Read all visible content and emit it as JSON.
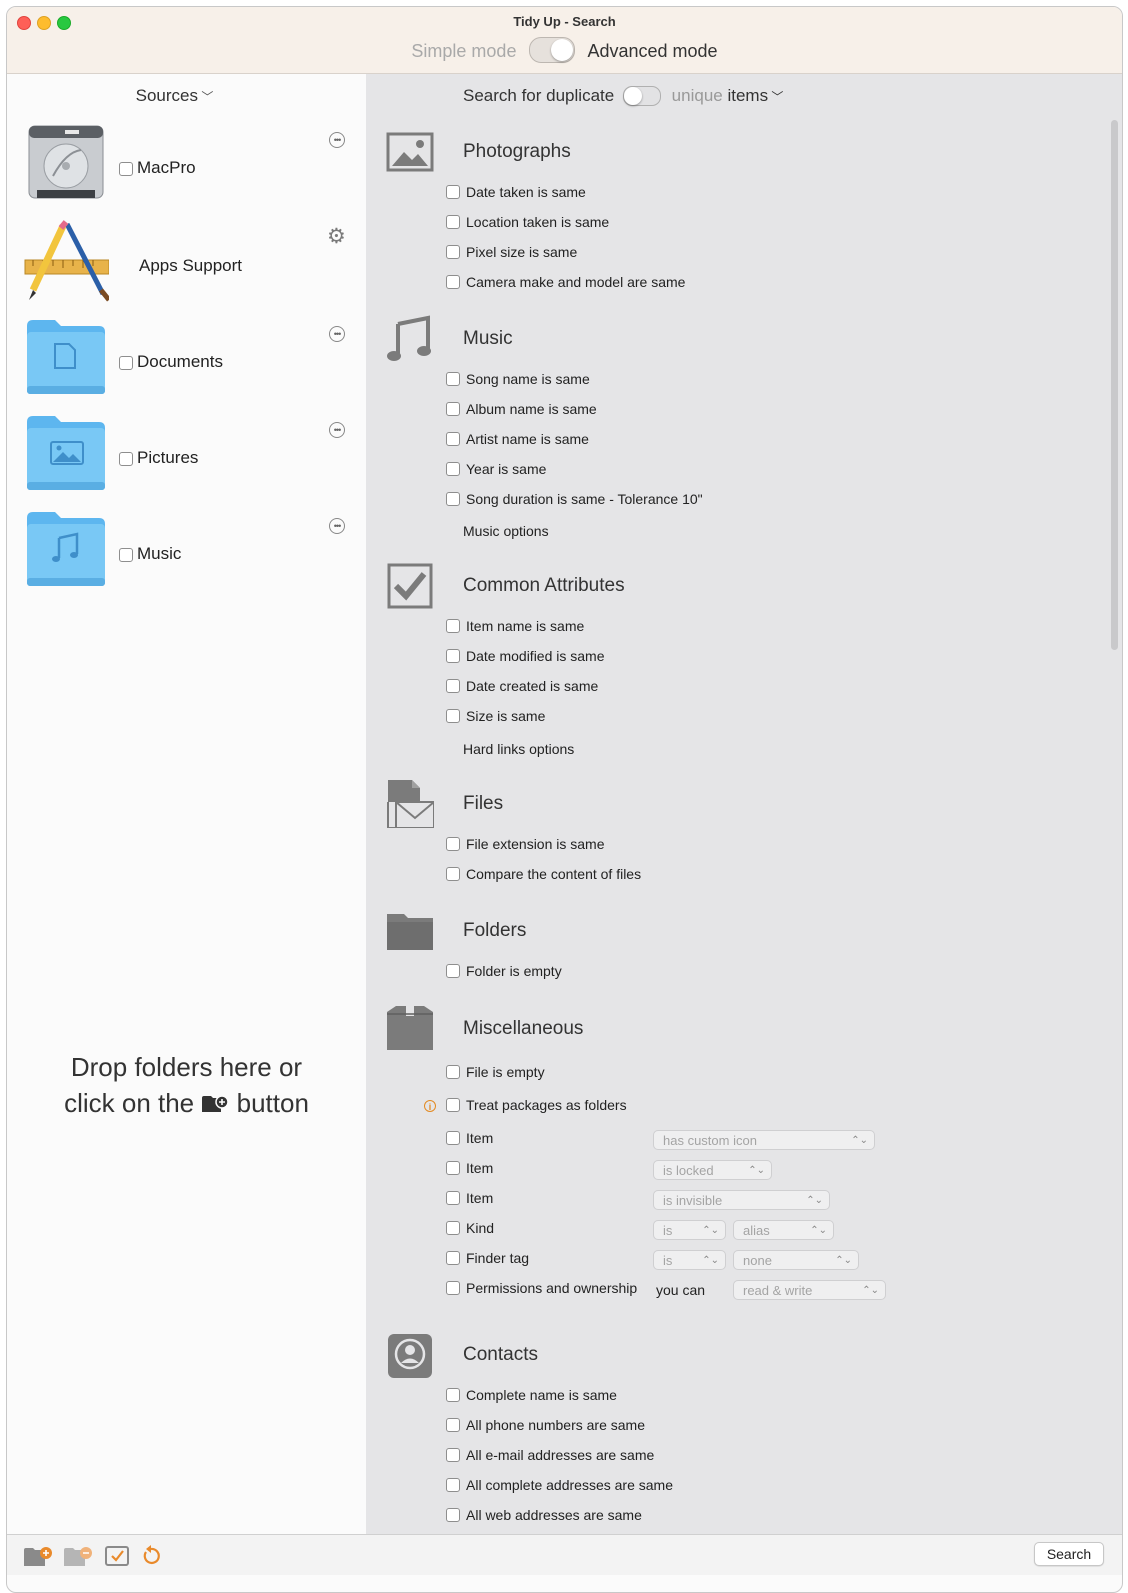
{
  "window": {
    "title": "Tidy Up - Search",
    "mode_simple": "Simple mode",
    "mode_advanced": "Advanced mode"
  },
  "sidebar": {
    "sources_label": "Sources",
    "sources": [
      {
        "label": "MacPro",
        "icon": "hard-drive-icon",
        "checked": false
      },
      {
        "label": "Apps Support",
        "icon": "applications-icon"
      },
      {
        "label": "Documents",
        "icon": "documents-folder-icon",
        "checked": false
      },
      {
        "label": "Pictures",
        "icon": "pictures-folder-icon",
        "checked": false
      },
      {
        "label": "Music",
        "icon": "music-folder-icon",
        "checked": false
      }
    ],
    "drop_hint_1": "Drop folders here or",
    "drop_hint_2": "click on the",
    "drop_hint_3": "button"
  },
  "main": {
    "search_for": "Search for duplicate",
    "unique": "unique",
    "items": "items",
    "groups": {
      "photographs": {
        "title": "Photographs",
        "options": [
          "Date taken is same",
          "Location taken is same",
          "Pixel size is same",
          "Camera make and model are same"
        ]
      },
      "music": {
        "title": "Music",
        "options": [
          "Song name is same",
          "Album name is same",
          "Artist name is same",
          "Year is same",
          "Song duration is same - Tolerance 10\""
        ],
        "extra": "Music options"
      },
      "common": {
        "title": "Common Attributes",
        "options": [
          "Item name is same",
          "Date modified is same",
          "Date created is same",
          "Size is same"
        ],
        "extra": "Hard links options"
      },
      "files": {
        "title": "Files",
        "options": [
          "File extension is same",
          "Compare the content of files"
        ]
      },
      "folders": {
        "title": "Folders",
        "options": [
          "Folder is empty"
        ]
      },
      "misc": {
        "title": "Miscellaneous",
        "options": [
          "File is empty",
          "Treat packages as folders"
        ],
        "rows": [
          {
            "label": "Item",
            "select1": "has custom icon"
          },
          {
            "label": "Item",
            "select1": "is locked"
          },
          {
            "label": "Item",
            "select1": "is invisible"
          },
          {
            "label": "Kind",
            "select1": "is",
            "select2": "alias"
          },
          {
            "label": "Finder tag",
            "select1": "is",
            "select2": "none"
          },
          {
            "label": "Permissions and ownership",
            "middle": "you can",
            "select2": "read & write"
          }
        ]
      },
      "contacts": {
        "title": "Contacts",
        "options": [
          "Complete name is same",
          "All phone numbers are same",
          "All e-mail addresses are same",
          "All complete addresses are same",
          "All web addresses are same"
        ]
      }
    }
  },
  "bottom": {
    "search_button": "Search"
  }
}
